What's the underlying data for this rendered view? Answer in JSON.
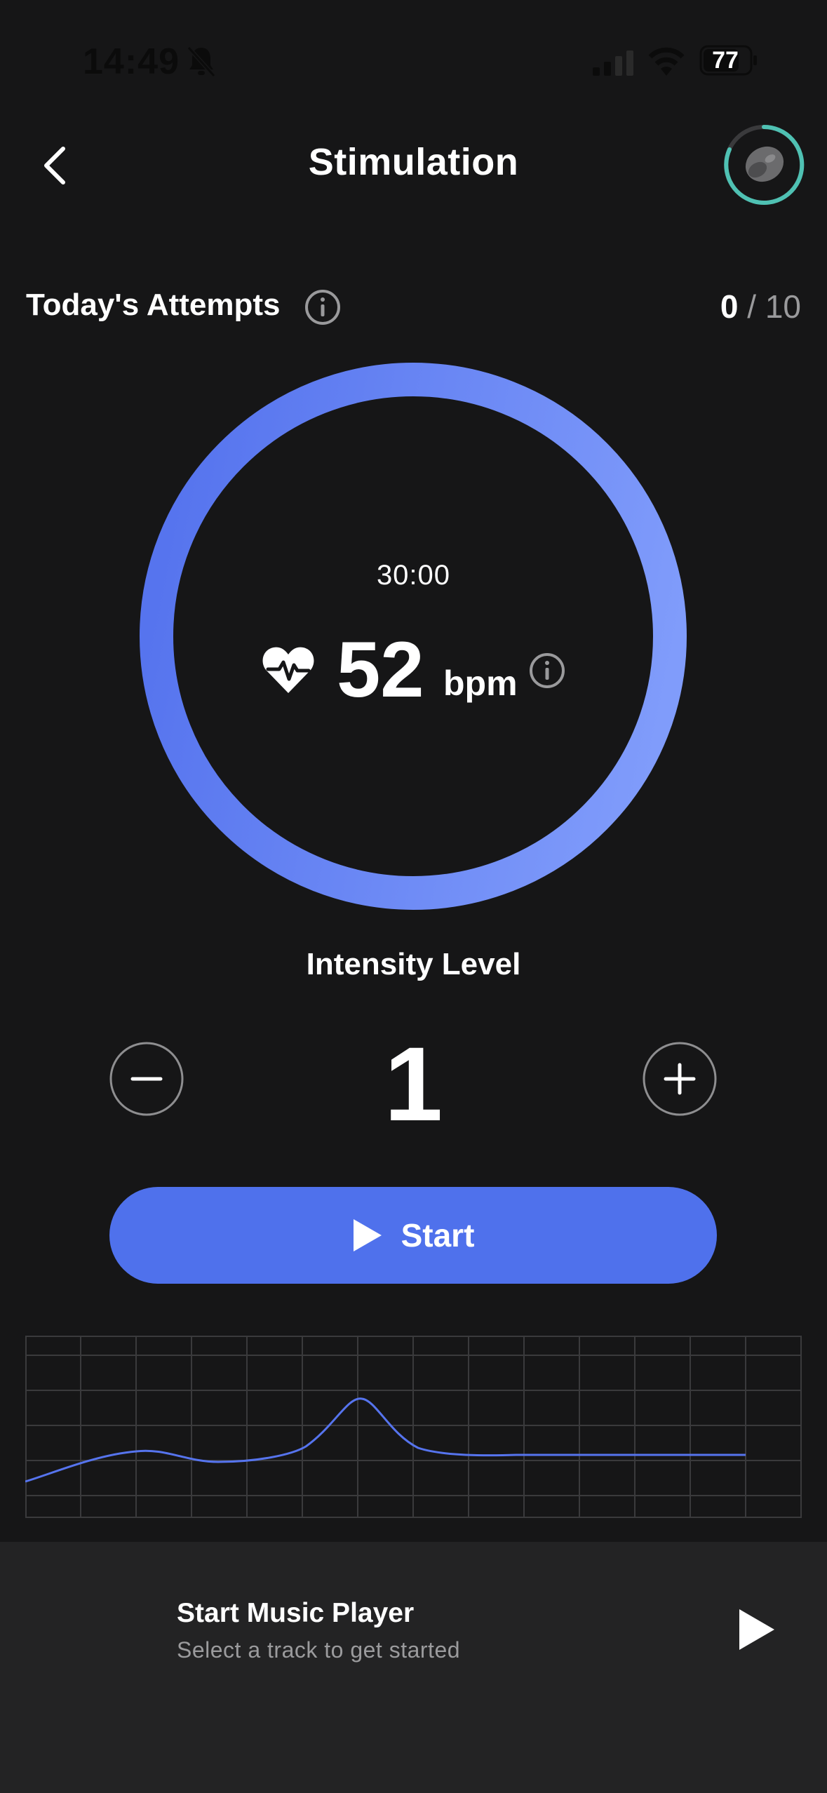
{
  "status_bar": {
    "time": "14:49",
    "battery": "77",
    "icons": [
      "bell-off-icon",
      "signal-icon",
      "wifi-icon",
      "battery-icon"
    ]
  },
  "header": {
    "title": "Stimulation",
    "back_icon": "chevron-left-icon",
    "avatar_icon": "earbud-device-icon"
  },
  "attempts": {
    "label": "Today's Attempts",
    "current": "0",
    "separator": "/",
    "max": "10"
  },
  "session": {
    "timer": "30:00",
    "heart_rate": "52",
    "heart_rate_unit": "bpm"
  },
  "intensity": {
    "label": "Intensity Level",
    "value": "1"
  },
  "start_button": {
    "label": "Start"
  },
  "music_player": {
    "title": "Start Music Player",
    "subtitle": "Select a track to get started"
  },
  "colors": {
    "background": "#161617",
    "accent": "#4f71ec",
    "ring_light": "#7f9bfa",
    "avatar_ring": "#4fc1b3",
    "panel": "#232324"
  }
}
